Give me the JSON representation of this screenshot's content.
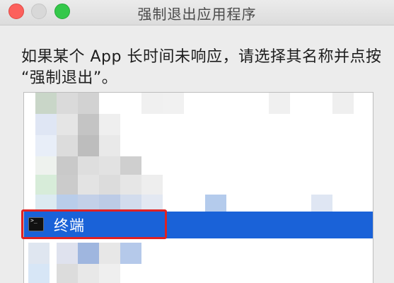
{
  "window": {
    "title": "强制退出应用程序"
  },
  "instructions": {
    "line1": "如果某个 App 长时间未响应，请选择其名称并点按",
    "line2": "“强制退出”。"
  },
  "app_list": {
    "selected_item": {
      "label": "终端",
      "icon": "terminal-icon"
    }
  },
  "colors": {
    "selection": "#1a62d8",
    "highlight_annotation": "#e02222"
  }
}
